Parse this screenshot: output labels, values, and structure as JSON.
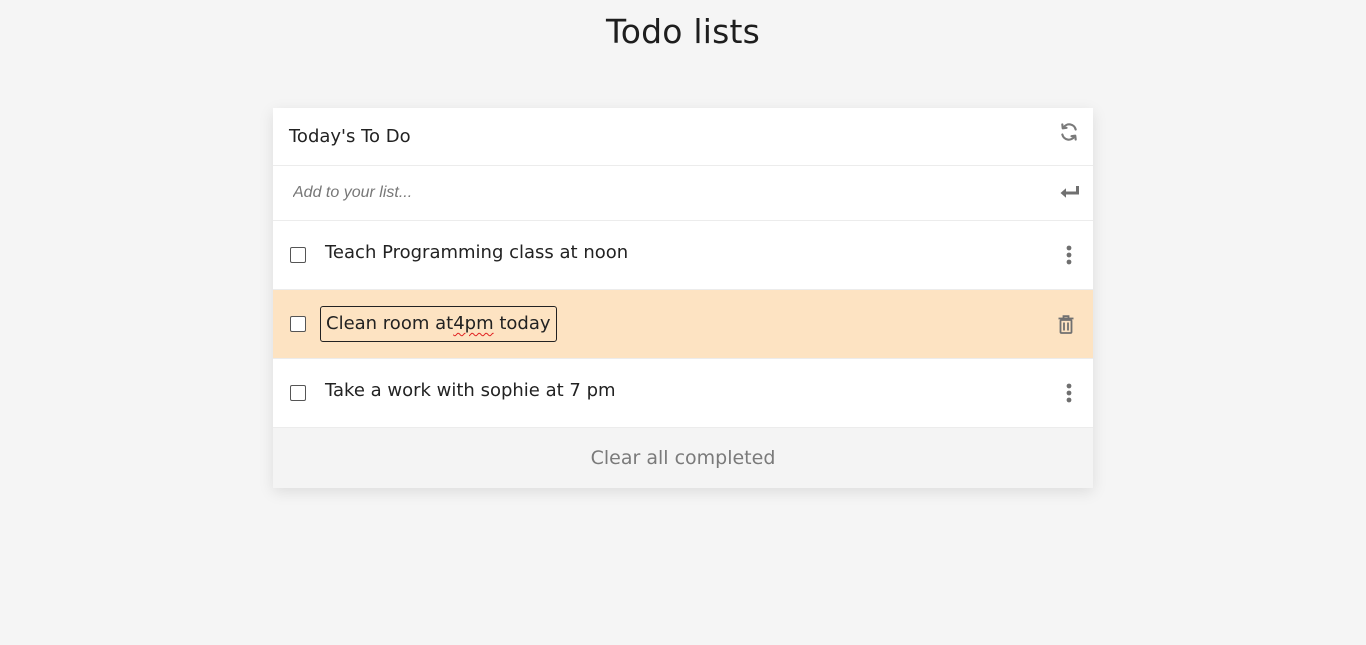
{
  "page": {
    "title": "Todo lists"
  },
  "card": {
    "title": "Today's To Do",
    "refresh_icon": "refresh-icon",
    "add_placeholder": "Add to your list...",
    "enter_icon": "enter-icon"
  },
  "todos": [
    {
      "text": "Teach Programming class at noon",
      "checked": false,
      "icon": "more-vertical-icon"
    },
    {
      "text_before": "Clean room at ",
      "text_misspelled": "4pm",
      "text_after": " today",
      "checked": false,
      "editing": true,
      "icon": "trash-icon"
    },
    {
      "text": "Take a work with sophie at 7 pm",
      "checked": false,
      "icon": "more-vertical-icon"
    }
  ],
  "footer": {
    "clear_label": "Clear all completed"
  },
  "colors": {
    "background": "#f5f5f5",
    "highlight_row": "#fde3c2",
    "icon": "#777777"
  }
}
